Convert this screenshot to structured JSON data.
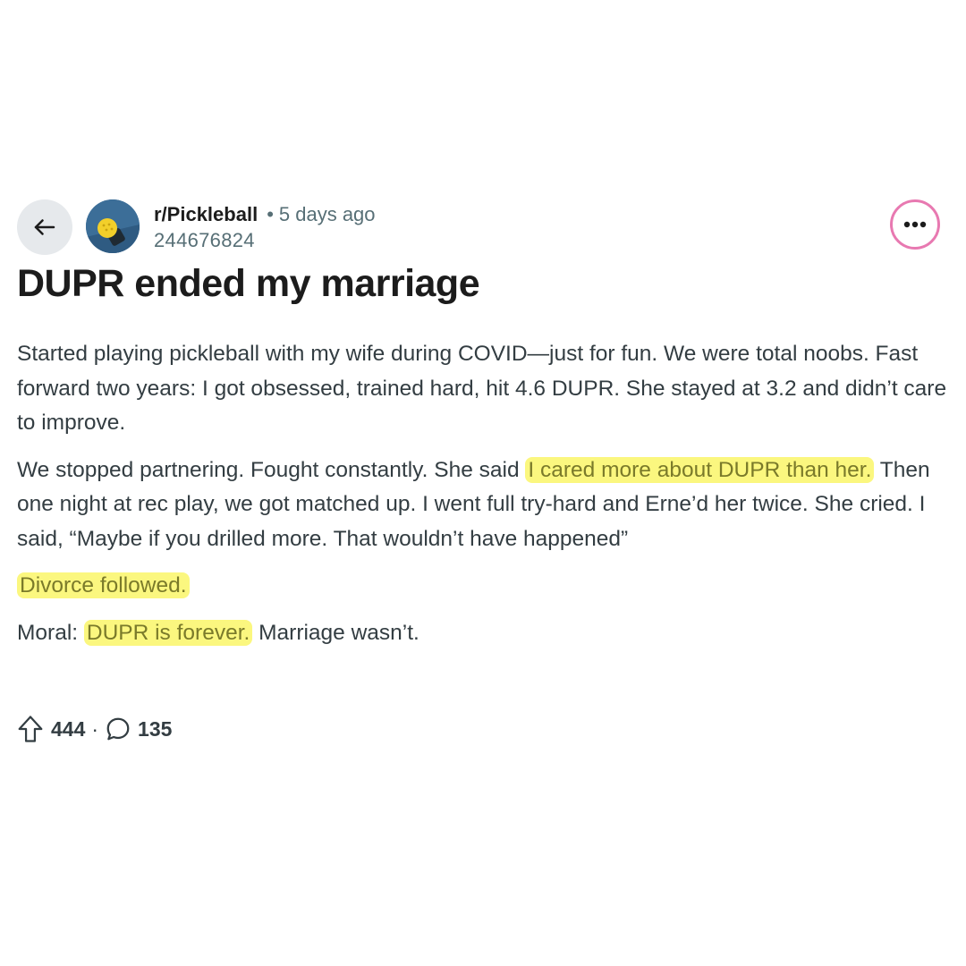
{
  "header": {
    "back_icon": "arrow-left-icon",
    "subreddit": "r/Pickleball",
    "separator": "•",
    "time_ago": "5 days ago",
    "author": "244676824",
    "more_icon": "ellipsis-icon"
  },
  "post": {
    "title": "DUPR ended my marriage",
    "paragraph1": "Started playing pickleball with my wife during COVID—just for fun. We were total noobs. Fast forward two years: I got obsessed, trained hard, hit 4.6 DUPR. She stayed at 3.2 and didn’t care to improve.",
    "paragraph2_a": "We stopped partnering. Fought constantly. She said ",
    "paragraph2_highlight": "I cared more about DUPR than her.",
    "paragraph2_b": " Then one night at rec play, we got matched up. I went full try-hard and Erne’d her twice. She cried. I said, “Maybe if you drilled more. That wouldn’t have happened”",
    "paragraph3_highlight": "Divorce followed.",
    "paragraph4_a": "Moral: ",
    "paragraph4_highlight": "DUPR is forever.",
    "paragraph4_b": " Marriage wasn’t."
  },
  "stats": {
    "upvote_icon": "upvote-arrow-icon",
    "upvotes": "444",
    "separator": "·",
    "comment_icon": "comment-bubble-icon",
    "comments": "135"
  },
  "colors": {
    "highlight": "#fbf77f",
    "highlight_text": "#7a7a2a",
    "more_button_ring": "#e879b1",
    "avatar_bg": "#3c6e98"
  }
}
